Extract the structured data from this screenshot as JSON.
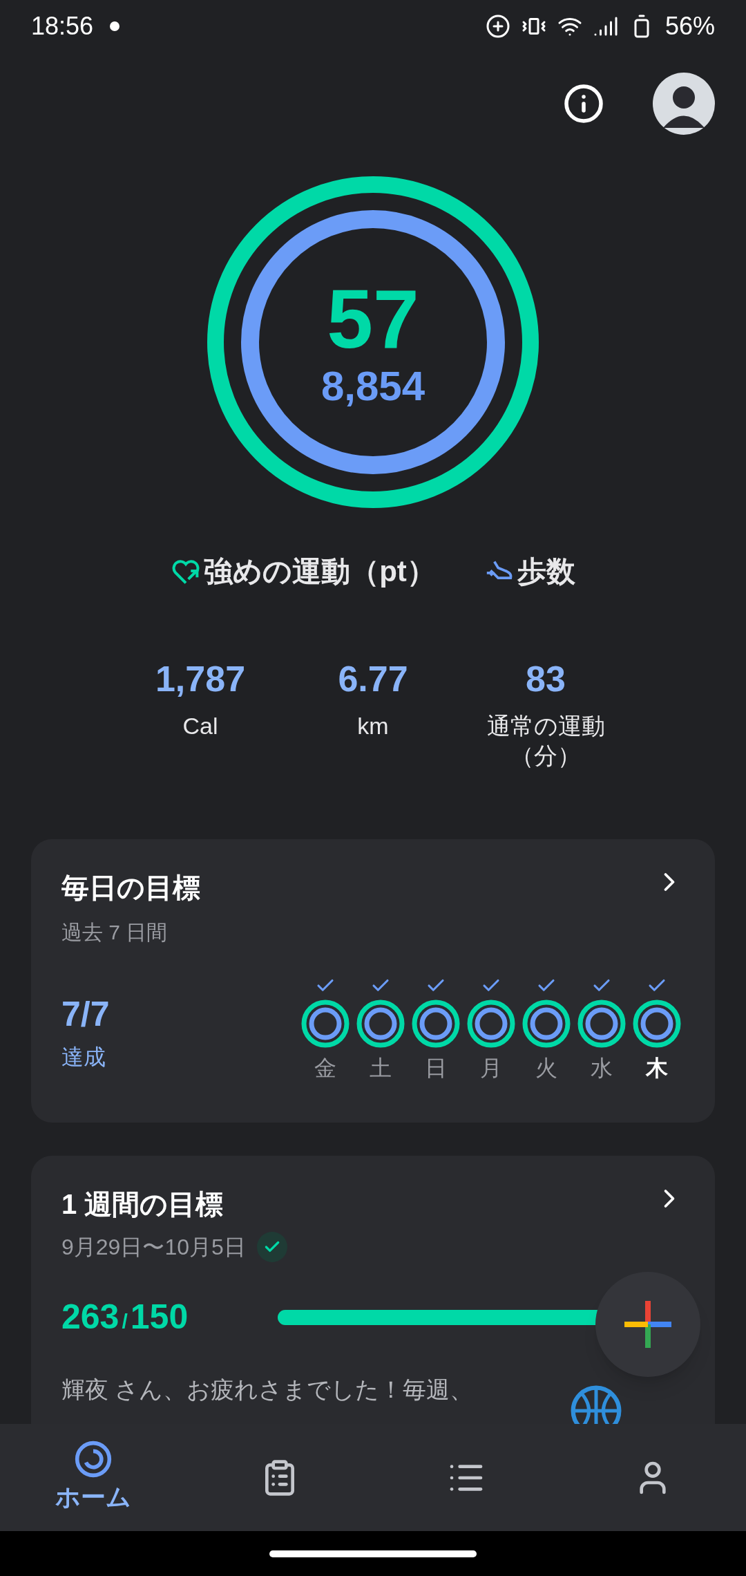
{
  "status_bar": {
    "time": "18:56",
    "battery": "56%"
  },
  "rings": {
    "heart_points": "57",
    "steps": "8,854"
  },
  "legend": [
    {
      "kind": "heart",
      "label": "強めの運動（pt）"
    },
    {
      "kind": "steps",
      "label": "歩数"
    }
  ],
  "stats": [
    {
      "value": "1,787",
      "label": "Cal"
    },
    {
      "value": "6.77",
      "label": "km"
    },
    {
      "value": "83",
      "label": "通常の運動（分）"
    }
  ],
  "daily_goal": {
    "title": "毎日の目標",
    "subtitle": "過去 7 日間",
    "score": "7/7",
    "score_label": "達成",
    "days": [
      {
        "label": "金",
        "checked": true,
        "selected": false
      },
      {
        "label": "土",
        "checked": true,
        "selected": false
      },
      {
        "label": "日",
        "checked": true,
        "selected": false
      },
      {
        "label": "月",
        "checked": true,
        "selected": false
      },
      {
        "label": "火",
        "checked": true,
        "selected": false
      },
      {
        "label": "水",
        "checked": true,
        "selected": false
      },
      {
        "label": "木",
        "checked": true,
        "selected": true
      }
    ]
  },
  "weekly_goal": {
    "title": "1 週間の目標",
    "dates": "9月29日〜10月5日",
    "achieved": true,
    "current": "263",
    "separator": "/",
    "target": "150",
    "level": 1,
    "message": "輝夜 さん、お疲れさまでした！毎週、"
  },
  "bottom_nav": [
    {
      "kind": "home",
      "label": "ホーム",
      "selected": true
    },
    {
      "kind": "journal",
      "selected": false
    },
    {
      "kind": "browse",
      "selected": false
    },
    {
      "kind": "profile",
      "selected": false
    }
  ]
}
